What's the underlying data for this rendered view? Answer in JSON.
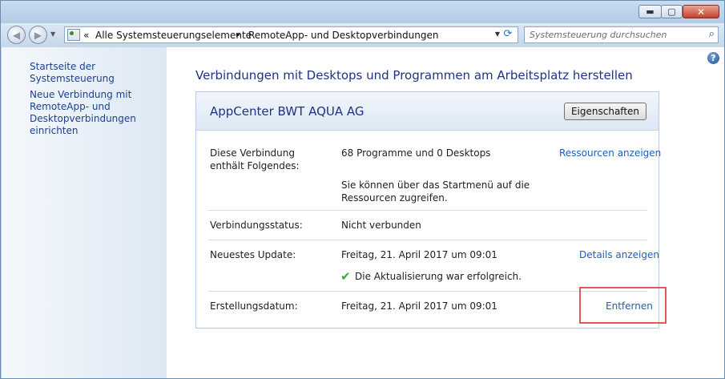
{
  "window": {
    "controls": {
      "minimize": "▬",
      "maximize": "▢",
      "close": "✕"
    }
  },
  "navbar": {
    "back_glyph": "◀",
    "forward_glyph": "▶",
    "breadcrumb": {
      "overflow": "«",
      "items": [
        "Alle Systemsteuerungselemente",
        "RemoteApp- und Desktopverbindungen"
      ],
      "separator": "▸"
    },
    "search_placeholder": "Systemsteuerung durchsuchen"
  },
  "sidebar": {
    "items": [
      {
        "label": "Startseite der Systemsteuerung"
      },
      {
        "label": "Neue Verbindung mit RemoteApp- und Desktopverbindungen einrichten"
      }
    ]
  },
  "main": {
    "help": "?",
    "heading": "Verbindungen mit Desktops und Programmen am Arbeitsplatz herstellen",
    "panel": {
      "title": "AppCenter BWT AQUA AG",
      "properties_button": "Eigenschaften",
      "rows": {
        "contains": {
          "label": "Diese Verbindung enthält Folgendes:",
          "value": "68 Programme und 0 Desktops",
          "note": "Sie können über das Startmenü auf die Ressourcen zugreifen.",
          "link": "Ressourcen anzeigen"
        },
        "status": {
          "label": "Verbindungsstatus:",
          "value": "Nicht verbunden"
        },
        "update": {
          "label": "Neuestes Update:",
          "value": "Freitag, 21. April 2017 um 09:01",
          "result": "Die Aktualisierung war erfolgreich.",
          "link": "Details anzeigen"
        },
        "created": {
          "label": "Erstellungsdatum:",
          "value": "Freitag, 21. April 2017 um 09:01",
          "link": "Entfernen"
        }
      }
    }
  },
  "colors": {
    "link": "#1d5fb5",
    "heading": "#1e3287",
    "highlight": "#e05a5a",
    "success": "#3da53d"
  }
}
